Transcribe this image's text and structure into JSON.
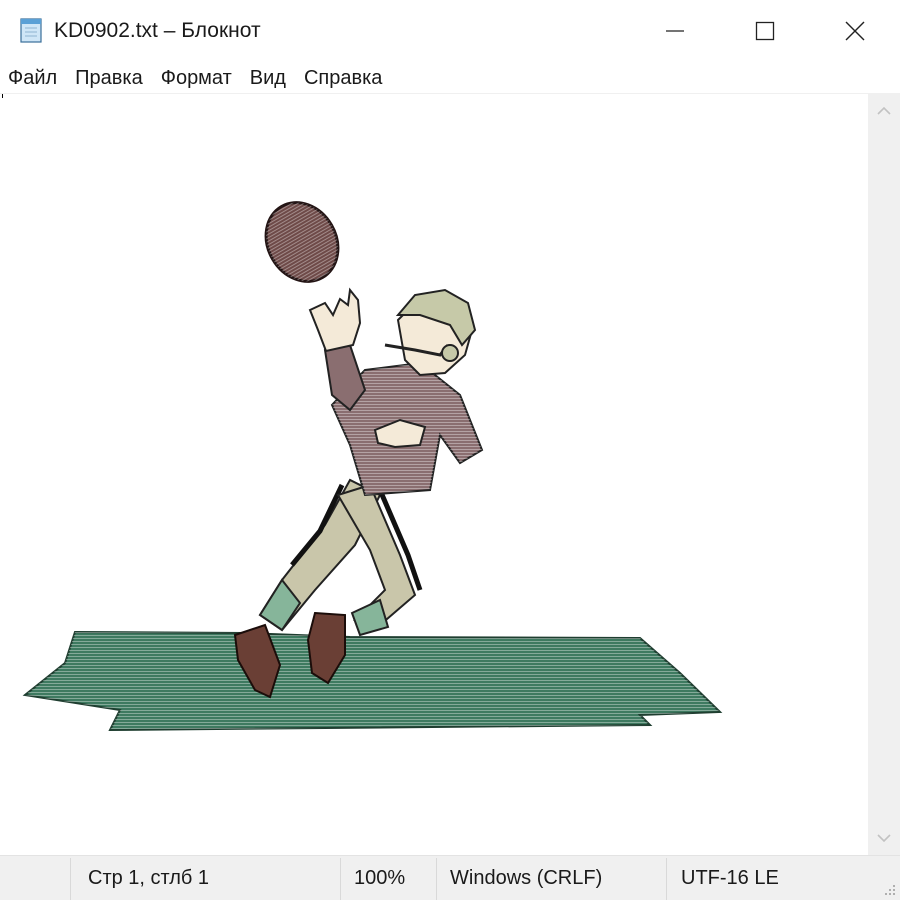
{
  "window": {
    "title": "KD0902.txt – Блокнот",
    "icon": "notepad-icon",
    "controls": {
      "minimize": "minimize-icon",
      "maximize": "maximize-icon",
      "close": "close-icon"
    }
  },
  "menu": [
    {
      "label": "Файл"
    },
    {
      "label": "Правка"
    },
    {
      "label": "Формат"
    },
    {
      "label": "Вид"
    },
    {
      "label": "Справка"
    }
  ],
  "editor": {
    "content": "football-player-catching-ball-illustration",
    "colors": {
      "ball": "#6e4a48",
      "shirt": "#8a6e70",
      "pants": "#c9c6aa",
      "socks": "#86b59a",
      "grass": "#3e7a60",
      "helmet": "#c6c9a8"
    }
  },
  "status": {
    "position": "Стр 1, стлб 1",
    "zoom": "100%",
    "line_endings": "Windows (CRLF)",
    "encoding": "UTF-16 LE"
  }
}
